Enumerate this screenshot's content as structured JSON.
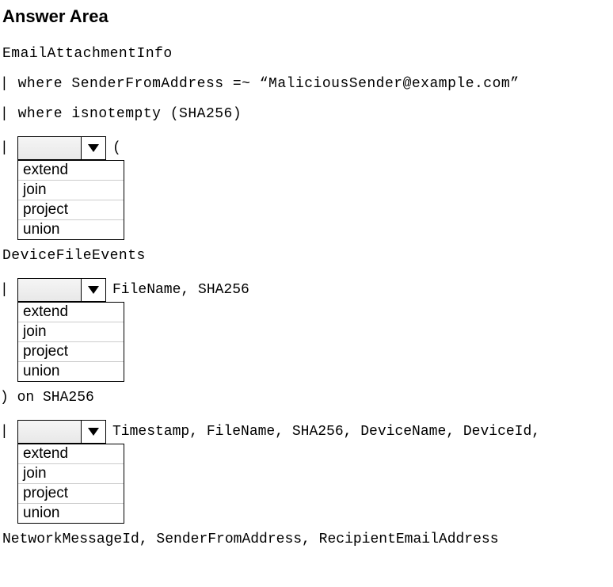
{
  "title": "Answer Area",
  "lines": {
    "l1": "EmailAttachmentInfo",
    "l2": "| where SenderFromAddress =~ “MaliciousSender@example.com”",
    "l3": "| where isnotempty (SHA256)",
    "after1": " (",
    "l4": "DeviceFileEvents",
    "after2": " FileName, SHA256",
    "l5": ") on SHA256",
    "after3": " Timestamp, FileName, SHA256, DeviceName, DeviceId,",
    "l6": "NetworkMessageId, SenderFromAddress, RecipientEmailAddress",
    "pipe": "|"
  },
  "dropdown": {
    "options": [
      "extend",
      "join",
      "project",
      "union"
    ]
  }
}
